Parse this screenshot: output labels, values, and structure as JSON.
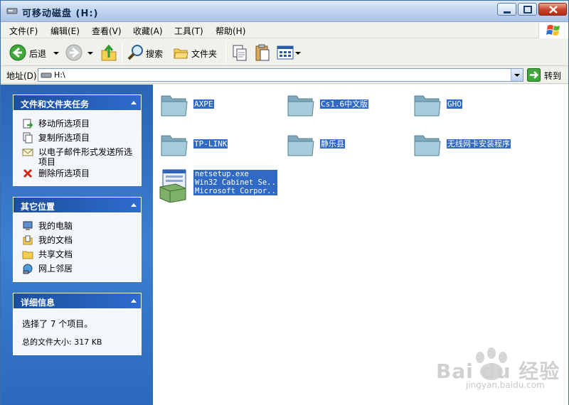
{
  "window": {
    "title": "可移动磁盘  (H:)"
  },
  "menu": {
    "items": [
      {
        "label": "文件(F)"
      },
      {
        "label": "编辑(E)"
      },
      {
        "label": "查看(V)"
      },
      {
        "label": "收藏(A)"
      },
      {
        "label": "工具(T)"
      },
      {
        "label": "帮助(H)"
      }
    ]
  },
  "toolbar": {
    "back_label": "后退",
    "search_label": "搜索",
    "folders_label": "文件夹"
  },
  "address": {
    "label": "地址(D)",
    "value": "H:\\",
    "go_label": "转到"
  },
  "tasks": {
    "file_tasks": {
      "title": "文件和文件夹任务",
      "items": [
        {
          "label": "移动所选项目",
          "icon": "move-icon"
        },
        {
          "label": "复制所选项目",
          "icon": "copy-icon"
        },
        {
          "label": "以电子邮件形式发送所选项目",
          "icon": "email-icon"
        },
        {
          "label": "删除所选项目",
          "icon": "delete-icon"
        }
      ]
    },
    "other_places": {
      "title": "其它位置",
      "items": [
        {
          "label": "我的电脑",
          "icon": "computer-icon"
        },
        {
          "label": "我的文档",
          "icon": "documents-icon"
        },
        {
          "label": "共享文档",
          "icon": "shared-folder-icon"
        },
        {
          "label": "网上邻居",
          "icon": "network-icon"
        }
      ]
    },
    "details": {
      "title": "详细信息",
      "selected": "选择了 7 个项目。",
      "total_size": "总的文件大小: 317 KB"
    }
  },
  "files": [
    {
      "name": "AXPE",
      "type": "folder"
    },
    {
      "name": "Cs1.6中文版",
      "type": "folder"
    },
    {
      "name": "GHO",
      "type": "folder"
    },
    {
      "name": "TP-LINK",
      "type": "folder"
    },
    {
      "name": "静乐县",
      "type": "folder"
    },
    {
      "name": "无线网卡安装程序",
      "type": "folder"
    },
    {
      "name": "netsetup.exe",
      "type": "exe",
      "line2": "Win32 Cabinet Se...",
      "line3": "Microsoft Corpor..."
    }
  ],
  "watermark": {
    "brand": "Bai du 经验",
    "url": "jingyan.baidu.com"
  },
  "colors": {
    "selection": "#316ac5",
    "task_pane": "#2a64b6",
    "folder": "#8fb8cc"
  }
}
